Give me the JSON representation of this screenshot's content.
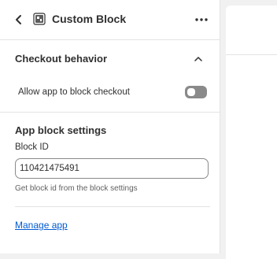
{
  "header": {
    "title": "Custom Block",
    "back_icon": "chevron-left-icon",
    "block_icon": "app-block-icon",
    "more_icon": "more-horizontal-icon"
  },
  "checkout_behavior": {
    "title": "Checkout behavior",
    "collapse_icon": "chevron-up-icon",
    "toggle_label": "Allow app to block checkout",
    "toggle_on": false
  },
  "app_block_settings": {
    "title": "App block settings",
    "block_id_label": "Block ID",
    "block_id_value": "110421475491",
    "help_text": "Get block id from the block settings"
  },
  "footer": {
    "manage_link": "Manage app"
  },
  "colors": {
    "link": "#005bd3",
    "toggle_off": "#8a8a8a",
    "border": "#e3e3e3"
  }
}
